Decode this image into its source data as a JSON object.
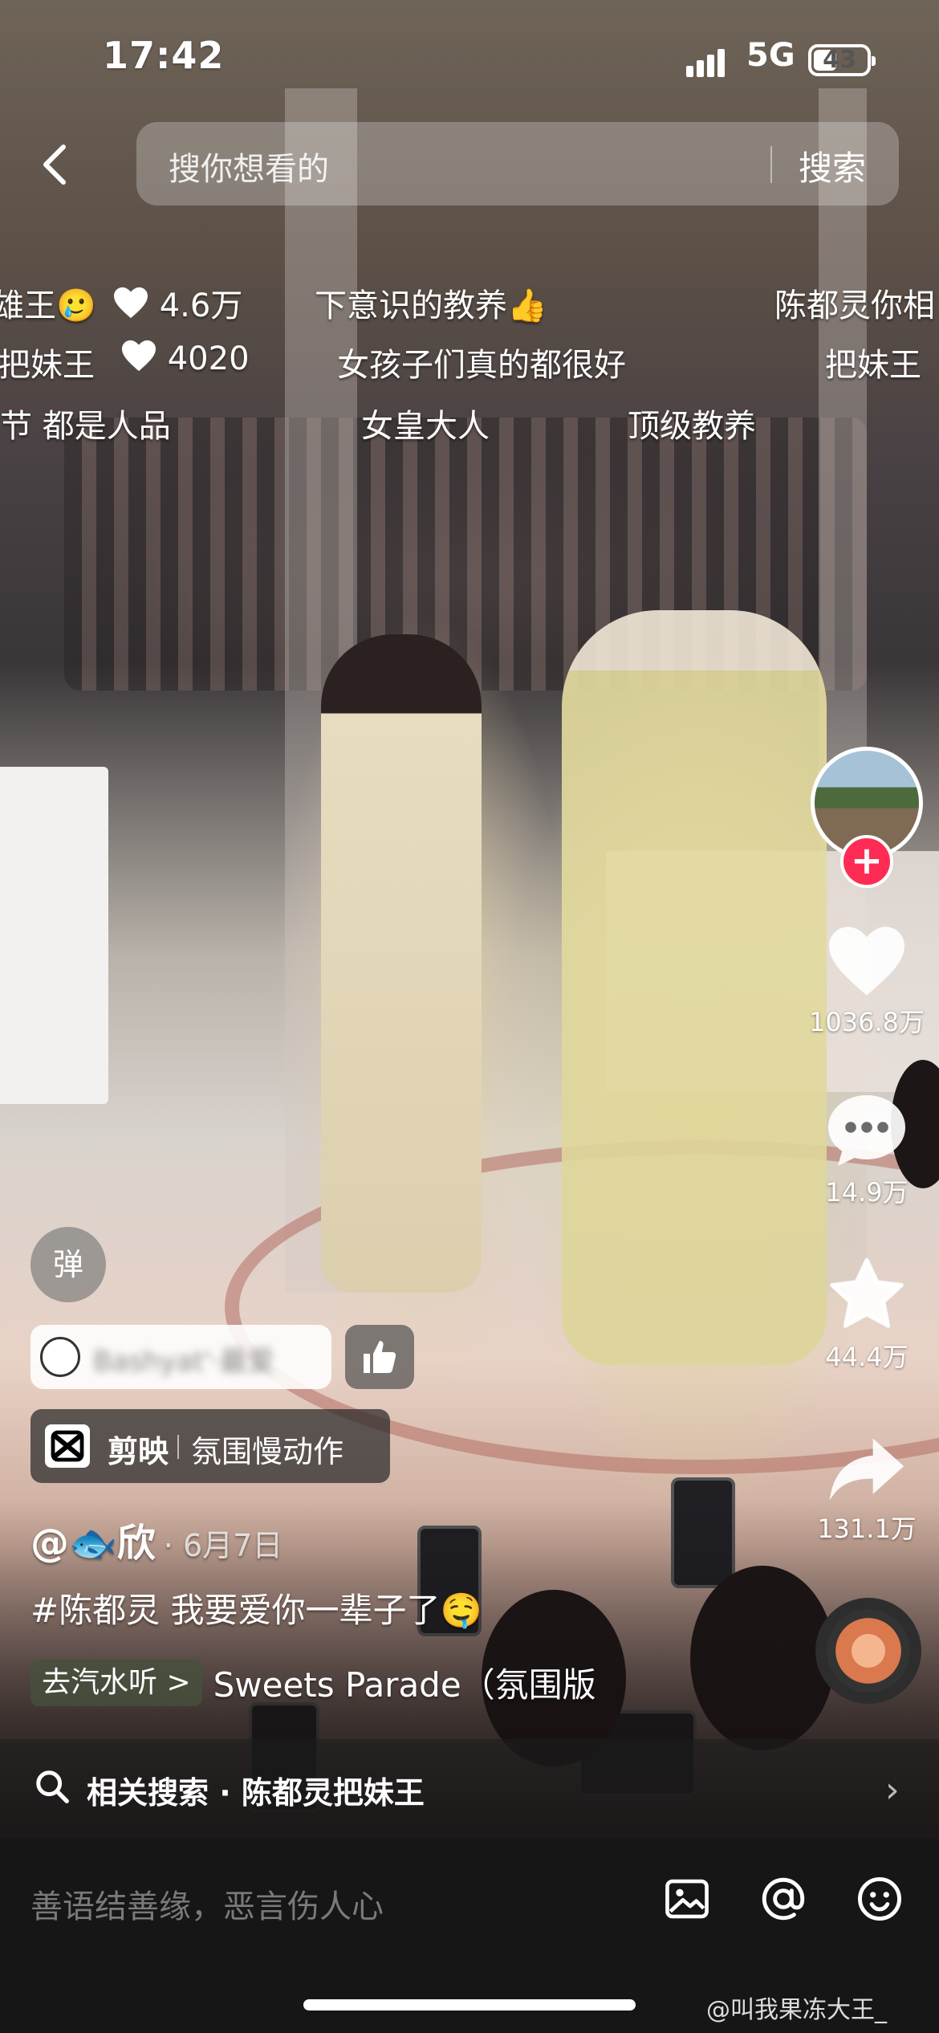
{
  "status_bar": {
    "time": "17:42",
    "network": "5G",
    "battery": "43",
    "battery_level": 0.43
  },
  "search": {
    "placeholder": "搜你想看的",
    "button": "搜索"
  },
  "danmaku": [
    {
      "text": "雄王🥲"
    },
    {
      "text": "4.6万"
    },
    {
      "text": "下意识的教养👍"
    },
    {
      "text": "陈都灵你相"
    },
    {
      "text": "把妹王"
    },
    {
      "text": "4020"
    },
    {
      "text": "女孩子们真的都很好"
    },
    {
      "text": "把妹王"
    },
    {
      "text": "节  都是人品"
    },
    {
      "text": "女皇大人"
    },
    {
      "text": "顶级教养"
    }
  ],
  "rail": {
    "likes": "1036.8万",
    "comments": "14.9万",
    "favorites": "44.4万",
    "shares": "131.1万",
    "follow_symbol": "+"
  },
  "danmu_toggle": "弹",
  "viewer": {
    "name": "Bashyat'·最爱"
  },
  "capcut": {
    "app": "剪映",
    "effect": "氛围慢动作"
  },
  "author": {
    "name": "@🐟欣",
    "date": "· 6月7日"
  },
  "caption": "#陈都灵  我要爱你一辈子了🤤",
  "music": {
    "tag": "去汽水听 >",
    "title": "Sweets Parade（氛围版"
  },
  "related": {
    "text": "相关搜索 · 陈都灵把妹王",
    "chevron": "›"
  },
  "comment": {
    "placeholder": "善语结善缘，恶言伤人心"
  },
  "watermark": "@叫我果冻大王_"
}
